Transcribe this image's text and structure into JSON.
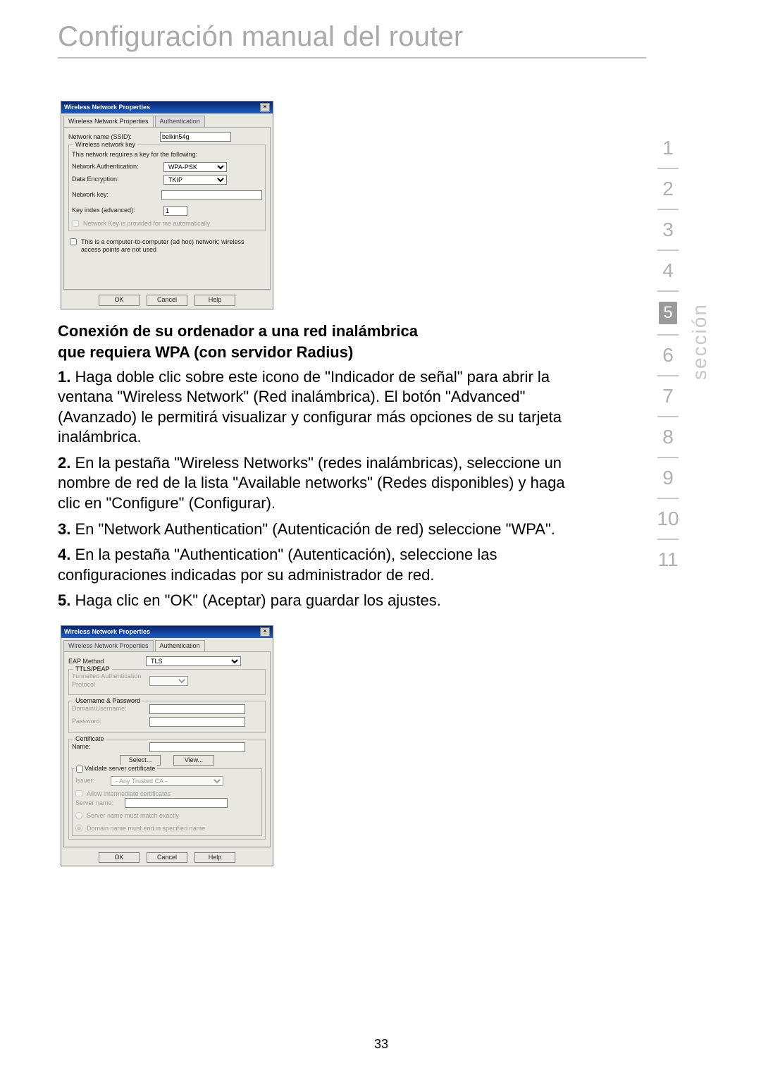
{
  "title": "Configuración manual del router",
  "seccion_label": "sección",
  "sections": [
    "1",
    "2",
    "3",
    "4",
    "5",
    "6",
    "7",
    "8",
    "9",
    "10",
    "11"
  ],
  "current_section": "5",
  "dialog1": {
    "title": "Wireless Network Properties",
    "tab_props": "Wireless Network Properties",
    "tab_auth": "Authentication",
    "ssid_label": "Network name (SSID):",
    "ssid_value": "belkin54g",
    "keygroup": "Wireless network key",
    "key_note": "This network requires a key for the following:",
    "auth_label": "Network Authentication:",
    "auth_value": "WPA-PSK",
    "enc_label": "Data Encryption:",
    "enc_value": "TKIP",
    "netkey_label": "Network key:",
    "keyindex_label": "Key index (advanced):",
    "keyindex_value": "1",
    "auto_key": "Network Key is provided for me automatically",
    "adhoc": "This is a computer-to-computer (ad hoc) network; wireless access points are not used",
    "ok": "OK",
    "cancel": "Cancel",
    "help": "Help"
  },
  "heading_line1": "Conexión de su ordenador a una red inalámbrica",
  "heading_line2": "que requiera WPA (con servidor Radius)",
  "steps": {
    "s1b": "1.",
    "s1": " Haga doble clic sobre este icono de \"Indicador de señal\" para abrir la ventana \"Wireless Network\" (Red inalámbrica). El botón \"Advanced\" (Avanzado) le permitirá visualizar y configurar más opciones de su tarjeta inalámbrica.",
    "s2b": "2.",
    "s2": " En la pestaña \"Wireless Networks\" (redes inalámbricas), seleccione un nombre de red de la lista \"Available networks\" (Redes disponibles) y haga clic en \"Configure\" (Configurar).",
    "s3b": "3.",
    "s3": " En \"Network Authentication\" (Autenticación de red) seleccione \"WPA\".",
    "s4b": "4.",
    "s4": " En la pestaña \"Authentication\" (Autenticación), seleccione las configuraciones indicadas por su administrador de red.",
    "s5b": "5.",
    "s5": " Haga clic en \"OK\" (Aceptar) para guardar los ajustes."
  },
  "dialog2": {
    "title": "Wireless Network Properties",
    "tab_props": "Wireless Network Properties",
    "tab_auth": "Authentication",
    "eap_label": "EAP Method",
    "eap_value": "TLS",
    "ttls_group": "TTLS/PEAP",
    "tap_label": "Tunnelled Authentication Protocol",
    "up_group": "Username & Password",
    "domain_label": "Domain\\Username:",
    "pwd_label": "Password:",
    "cert_group": "Certificate",
    "name_label": "Name:",
    "select": "Select...",
    "view": "View...",
    "validate": "Validate server certificate",
    "issuer_label": "Issuer:",
    "issuer_value": "- Any Trusted CA -",
    "allow_inter": "Allow intermediate certificates",
    "server_label": "Server name:",
    "r1": "Server name must match exactly",
    "r2": "Domain name must end in specified name",
    "ok": "OK",
    "cancel": "Cancel",
    "help": "Help"
  },
  "page_number": "33"
}
